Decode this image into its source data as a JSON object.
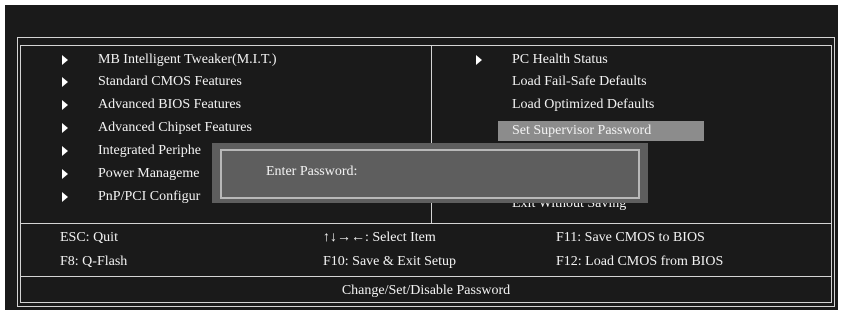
{
  "left_menu": [
    {
      "label": "MB Intelligent Tweaker(M.I.T.)"
    },
    {
      "label": "Standard CMOS Features"
    },
    {
      "label": "Advanced BIOS Features"
    },
    {
      "label": "Advanced Chipset Features"
    },
    {
      "label": "Integrated Periphe"
    },
    {
      "label": "Power Manageme"
    },
    {
      "label": "PnP/PCI Configur"
    }
  ],
  "right_menu": [
    {
      "label": "PC Health Status",
      "has_arrow": true
    },
    {
      "label": "Load Fail-Safe Defaults"
    },
    {
      "label": "Load Optimized Defaults"
    },
    {
      "label": "Set Supervisor Password",
      "selected": true
    },
    {
      "label": "Exit Without Saving"
    }
  ],
  "dialog": {
    "prompt": "Enter Password:",
    "value": ""
  },
  "help_keys": {
    "esc": "ESC: Quit",
    "nav": "↑↓→←: Select Item",
    "f11": "F11: Save CMOS to BIOS",
    "f8": "F8: Q-Flash",
    "f10": "F10: Save & Exit Setup",
    "f12": "F12: Load CMOS from BIOS"
  },
  "status_text": "Change/Set/Disable Password",
  "colors": {
    "background": "#1a1a1a",
    "highlight": "#8c8c8c",
    "dialog": "#5e5e5e",
    "text": "#f2f2f2"
  }
}
